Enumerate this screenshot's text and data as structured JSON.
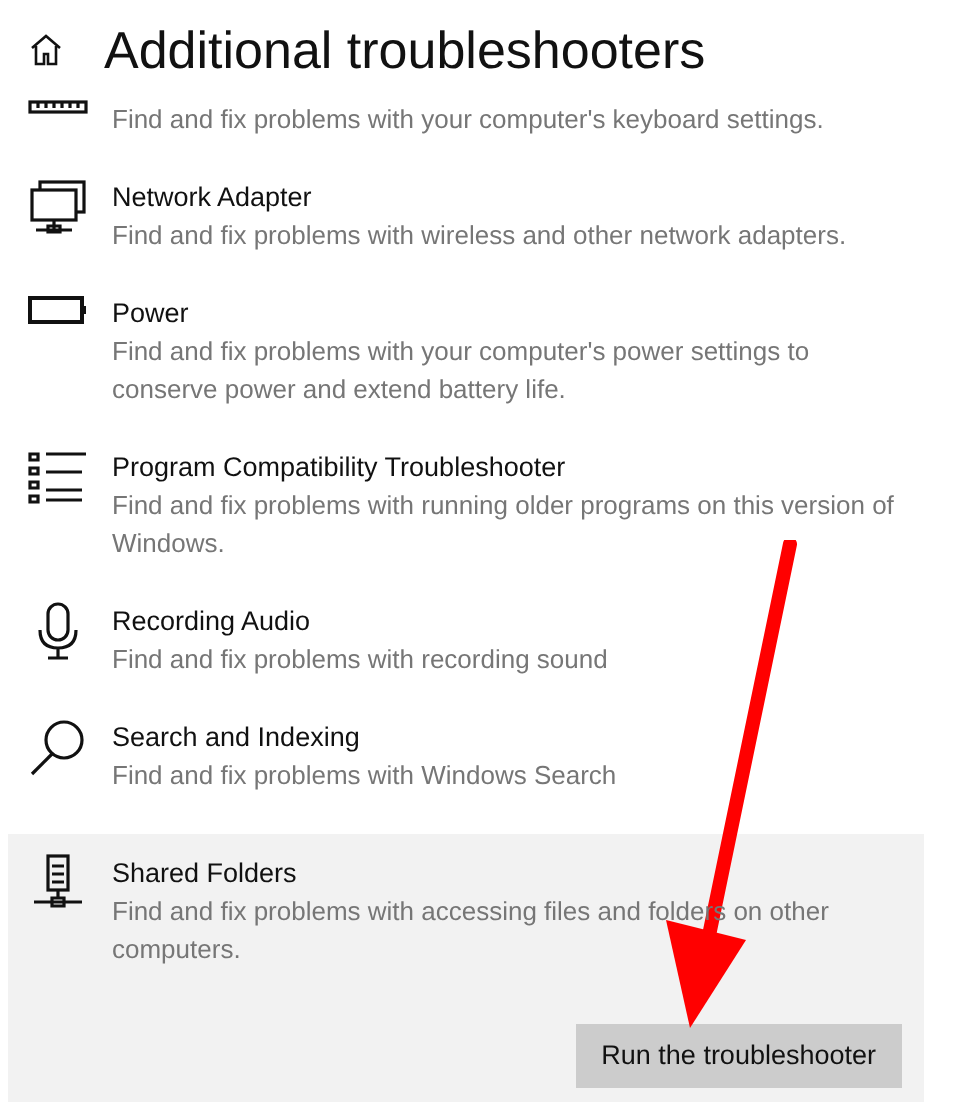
{
  "header": {
    "title": "Additional troubleshooters"
  },
  "troubleshooters": [
    {
      "kind": "keyboard",
      "description": "Find and fix problems with your computer's keyboard settings.",
      "selected": false
    },
    {
      "kind": "network",
      "title": "Network Adapter",
      "description": "Find and fix problems with wireless and other network adapters.",
      "selected": false
    },
    {
      "kind": "power",
      "title": "Power",
      "description": "Find and fix problems with your computer's power settings to conserve power and extend battery life.",
      "selected": false
    },
    {
      "kind": "program",
      "title": "Program Compatibility Troubleshooter",
      "description": "Find and fix problems with running older programs on this version of Windows.",
      "selected": false
    },
    {
      "kind": "microphone",
      "title": "Recording Audio",
      "description": "Find and fix problems with recording sound",
      "selected": false
    },
    {
      "kind": "search",
      "title": "Search and Indexing",
      "description": "Find and fix problems with Windows Search",
      "selected": false
    },
    {
      "kind": "shared",
      "title": "Shared Folders",
      "description": "Find and fix problems with accessing files and folders on other computers.",
      "selected": true,
      "button": "Run the troubleshooter"
    }
  ]
}
